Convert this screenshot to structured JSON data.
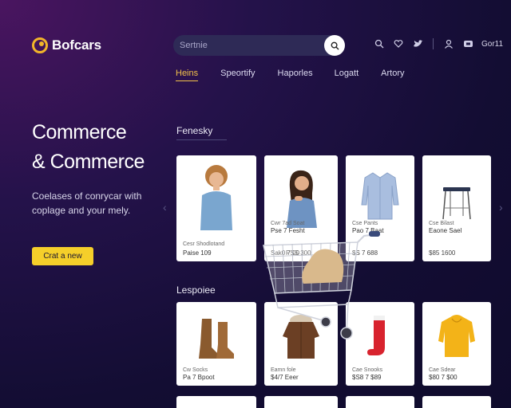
{
  "brand": {
    "name": "Bofcars"
  },
  "search": {
    "placeholder": "Sertnie"
  },
  "header": {
    "account_label": "Gor11"
  },
  "nav": [
    {
      "label": "Heins",
      "active": true
    },
    {
      "label": "Speortify",
      "active": false
    },
    {
      "label": "Haporles",
      "active": false
    },
    {
      "label": "Logatt",
      "active": false
    },
    {
      "label": "Artory",
      "active": false
    }
  ],
  "hero": {
    "title_line1": "Commerce",
    "title_line2": "& Commerce",
    "subtitle": "Coelases of conrycar with coplage and your mely.",
    "cta_label": "Crat a new"
  },
  "sections": [
    {
      "title": "Fenesky",
      "products": [
        {
          "icon": "woman-curly-hair-image",
          "name": "Cesr Shodlotand",
          "price": "Paise 109"
        },
        {
          "icon": "woman-long-hair-image",
          "name": "Cwr 7ad Soat",
          "price": "Pse 7 Fesht"
        },
        {
          "icon": "shirt-image",
          "name": "Cse Pants",
          "price": "Pao 7 Baat"
        },
        {
          "icon": "stool-image",
          "name": "Cse Bilast",
          "price": "Eaone Sael"
        }
      ]
    },
    {
      "title": "Lespoiee",
      "products": [
        {
          "icon": "boots-image",
          "name": "Cw Socks",
          "price": "Pa 7 Bpoot"
        },
        {
          "icon": "jacket-image",
          "name": "Eamn fole",
          "price": "$4/7 Eeer"
        },
        {
          "icon": "socks-image",
          "name": "Cae Snooks",
          "price": "$S8 7 $89"
        },
        {
          "icon": "hoodie-image",
          "name": "Cae Sdear",
          "price": "$80 7 $00"
        }
      ]
    }
  ],
  "overlay": {
    "prices": [
      "Sak0 7 00",
      "PSS 300",
      "$S 7 688",
      "$85 1600"
    ]
  }
}
